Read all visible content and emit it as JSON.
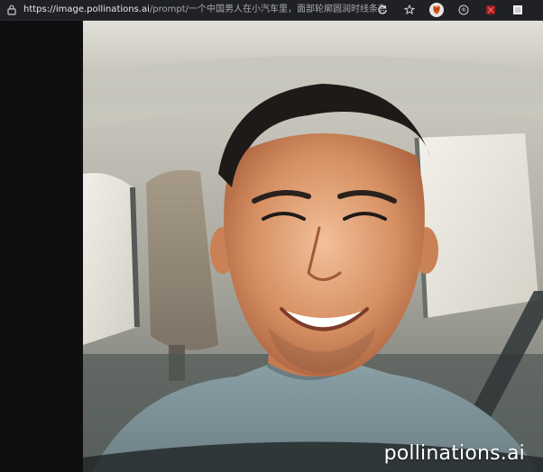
{
  "browser": {
    "url_host": "https://image.pollinations.ai",
    "url_path": "/prompt/一个中国男人在小汽车里，面部轮廓圆润时线条有立体感。笑容自...",
    "toolbar_icons": [
      "refresh-icon",
      "star-icon",
      "fox-extension-icon",
      "r-extension-icon",
      "red-extension-icon",
      "extension-square-icon"
    ]
  },
  "image": {
    "watermark": "pollinations.ai"
  },
  "colors": {
    "topbar_bg": "#202124",
    "left_panel": "#0f0f10"
  }
}
